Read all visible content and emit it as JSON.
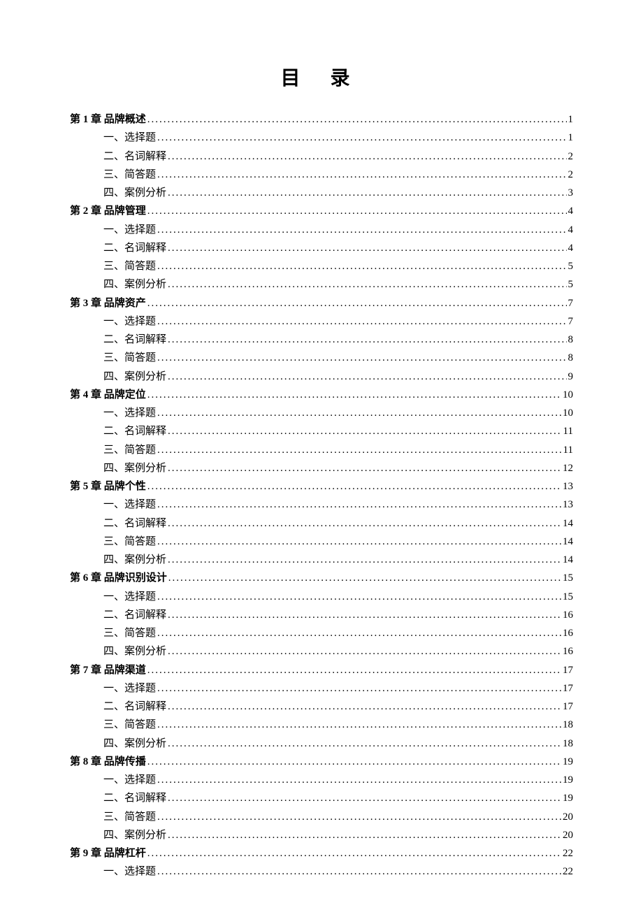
{
  "title": "目 录",
  "entries": [
    {
      "type": "chapter",
      "label": "第 1 章 品牌概述",
      "page": "1"
    },
    {
      "type": "section",
      "label": "一、选择题",
      "page": "1"
    },
    {
      "type": "section",
      "label": "二、名词解释",
      "page": "2"
    },
    {
      "type": "section",
      "label": "三、简答题",
      "page": "2"
    },
    {
      "type": "section",
      "label": "四、案例分析",
      "page": "3"
    },
    {
      "type": "chapter",
      "label": "第 2 章 品牌管理",
      "page": "4"
    },
    {
      "type": "section",
      "label": "一、选择题",
      "page": "4"
    },
    {
      "type": "section",
      "label": "二、名词解释",
      "page": "4"
    },
    {
      "type": "section",
      "label": "三、简答题",
      "page": "5"
    },
    {
      "type": "section",
      "label": "四、案例分析",
      "page": "5"
    },
    {
      "type": "chapter",
      "label": "第 3 章 品牌资产",
      "page": "7"
    },
    {
      "type": "section",
      "label": "一、选择题",
      "page": "7"
    },
    {
      "type": "section",
      "label": "二、名词解释",
      "page": "8"
    },
    {
      "type": "section",
      "label": "三、简答题",
      "page": "8"
    },
    {
      "type": "section",
      "label": "四、案例分析",
      "page": "9"
    },
    {
      "type": "chapter",
      "label": "第 4 章 品牌定位",
      "page": "10"
    },
    {
      "type": "section",
      "label": "一、选择题",
      "page": "10"
    },
    {
      "type": "section",
      "label": "二、名词解释",
      "page": "11"
    },
    {
      "type": "section",
      "label": "三、简答题",
      "page": "11"
    },
    {
      "type": "section",
      "label": "四、案例分析",
      "page": "12"
    },
    {
      "type": "chapter",
      "label": "第 5 章 品牌个性",
      "page": "13"
    },
    {
      "type": "section",
      "label": "一、选择题",
      "page": "13"
    },
    {
      "type": "section",
      "label": "二、名词解释",
      "page": "14"
    },
    {
      "type": "section",
      "label": "三、简答题",
      "page": "14"
    },
    {
      "type": "section",
      "label": "四、案例分析",
      "page": "14"
    },
    {
      "type": "chapter",
      "label": "第 6 章 品牌识别设计",
      "page": "15"
    },
    {
      "type": "section",
      "label": "一、选择题",
      "page": "15"
    },
    {
      "type": "section",
      "label": "二、名词解释",
      "page": "16"
    },
    {
      "type": "section",
      "label": "三、简答题",
      "page": "16"
    },
    {
      "type": "section",
      "label": "四、案例分析",
      "page": "16"
    },
    {
      "type": "chapter",
      "label": "第 7 章 品牌渠道",
      "page": "17"
    },
    {
      "type": "section",
      "label": "一、选择题",
      "page": "17"
    },
    {
      "type": "section",
      "label": "二、名词解释",
      "page": "17"
    },
    {
      "type": "section",
      "label": "三、简答题",
      "page": "18"
    },
    {
      "type": "section",
      "label": "四、案例分析",
      "page": "18"
    },
    {
      "type": "chapter",
      "label": "第 8 章 品牌传播",
      "page": "19"
    },
    {
      "type": "section",
      "label": "一、选择题",
      "page": "19"
    },
    {
      "type": "section",
      "label": "二、名词解释",
      "page": "19"
    },
    {
      "type": "section",
      "label": "三、简答题",
      "page": "20"
    },
    {
      "type": "section",
      "label": "四、案例分析",
      "page": "20"
    },
    {
      "type": "chapter",
      "label": "第 9 章 品牌杠杆",
      "page": "22"
    },
    {
      "type": "section",
      "label": "一、选择题",
      "page": "22"
    }
  ]
}
